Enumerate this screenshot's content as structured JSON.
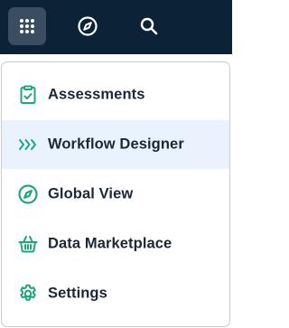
{
  "topbar": {
    "buttons": [
      {
        "icon": "apps-grid-icon",
        "active": true
      },
      {
        "icon": "compass-icon",
        "active": false
      },
      {
        "icon": "search-icon",
        "active": false
      }
    ],
    "background": "#0c2236"
  },
  "menu": {
    "items": [
      {
        "label": "Assessments",
        "icon": "clipboard-check-icon",
        "selected": false
      },
      {
        "label": "Workflow Designer",
        "icon": "triple-chevron-right-icon",
        "selected": true
      },
      {
        "label": "Global View",
        "icon": "compass-icon",
        "selected": false
      },
      {
        "label": "Data Marketplace",
        "icon": "basket-icon",
        "selected": false
      },
      {
        "label": "Settings",
        "icon": "gear-icon",
        "selected": false
      }
    ],
    "accent": "#1ea67c",
    "selected_background": "#eaf2fd"
  }
}
